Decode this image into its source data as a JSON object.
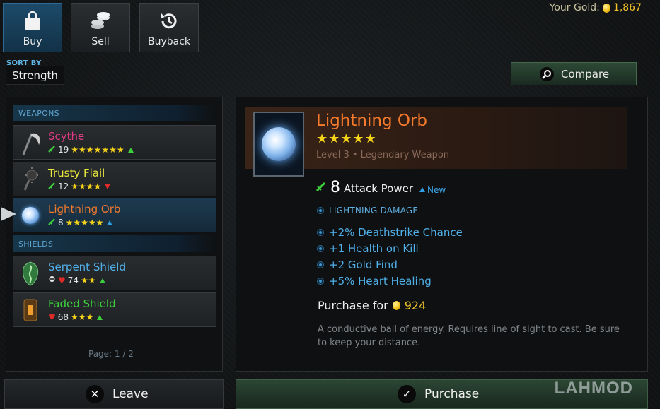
{
  "tabs": [
    {
      "label": "Buy",
      "icon": "shopping-bag-icon",
      "active": true
    },
    {
      "label": "Sell",
      "icon": "coin-stack-icon",
      "active": false
    },
    {
      "label": "Buyback",
      "icon": "history-icon",
      "active": false
    }
  ],
  "gold": {
    "label": "Your Gold:",
    "amount": "1,867"
  },
  "sort": {
    "label": "SORT BY",
    "value": "Strength"
  },
  "compare_label": "Compare",
  "sections": {
    "weapons": "WEAPONS",
    "shields": "SHIELDS"
  },
  "items": [
    {
      "name": "Scythe",
      "stat": "19",
      "stars": 7,
      "trend": "up",
      "name_color": "#e23b86"
    },
    {
      "name": "Trusty Flail",
      "stat": "12",
      "stars": 4,
      "trend": "down",
      "name_color": "#e8e63a"
    },
    {
      "name": "Lightning Orb",
      "stat": "8",
      "stars": 5,
      "trend": "up-blue",
      "name_color": "#f57a2c"
    },
    {
      "name": "Serpent Shield",
      "stat": "74",
      "stars": 2,
      "trend": "up",
      "name_color": "#4fb0ea"
    },
    {
      "name": "Faded Shield",
      "stat": "68",
      "stars": 3,
      "trend": "up",
      "name_color": "#3cd13c"
    }
  ],
  "page_indicator": "Page: 1 / 2",
  "detail": {
    "title": "Lightning Orb",
    "stars": 5,
    "subtitle": "Level 3 • Legendary Weapon",
    "attack_value": "8",
    "attack_label": "Attack Power",
    "new_label": "New",
    "damage_type": "LIGHTNING DAMAGE",
    "bonuses": [
      "+2% Deathstrike Chance",
      "+1 Health on Kill",
      "+2 Gold Find",
      "+5% Heart Healing"
    ],
    "purchase_label": "Purchase for",
    "price": "924",
    "description": "A conductive ball of energy. Requires line of sight to cast. Be sure to keep your distance."
  },
  "buttons": {
    "leave": "Leave",
    "purchase": "Purchase"
  },
  "watermark": "LAHMOD",
  "colors": {
    "accent_blue": "#4fb0ea",
    "legendary_orange": "#f57a2c",
    "gold": "#f1c22b",
    "star": "#f4d21a"
  }
}
